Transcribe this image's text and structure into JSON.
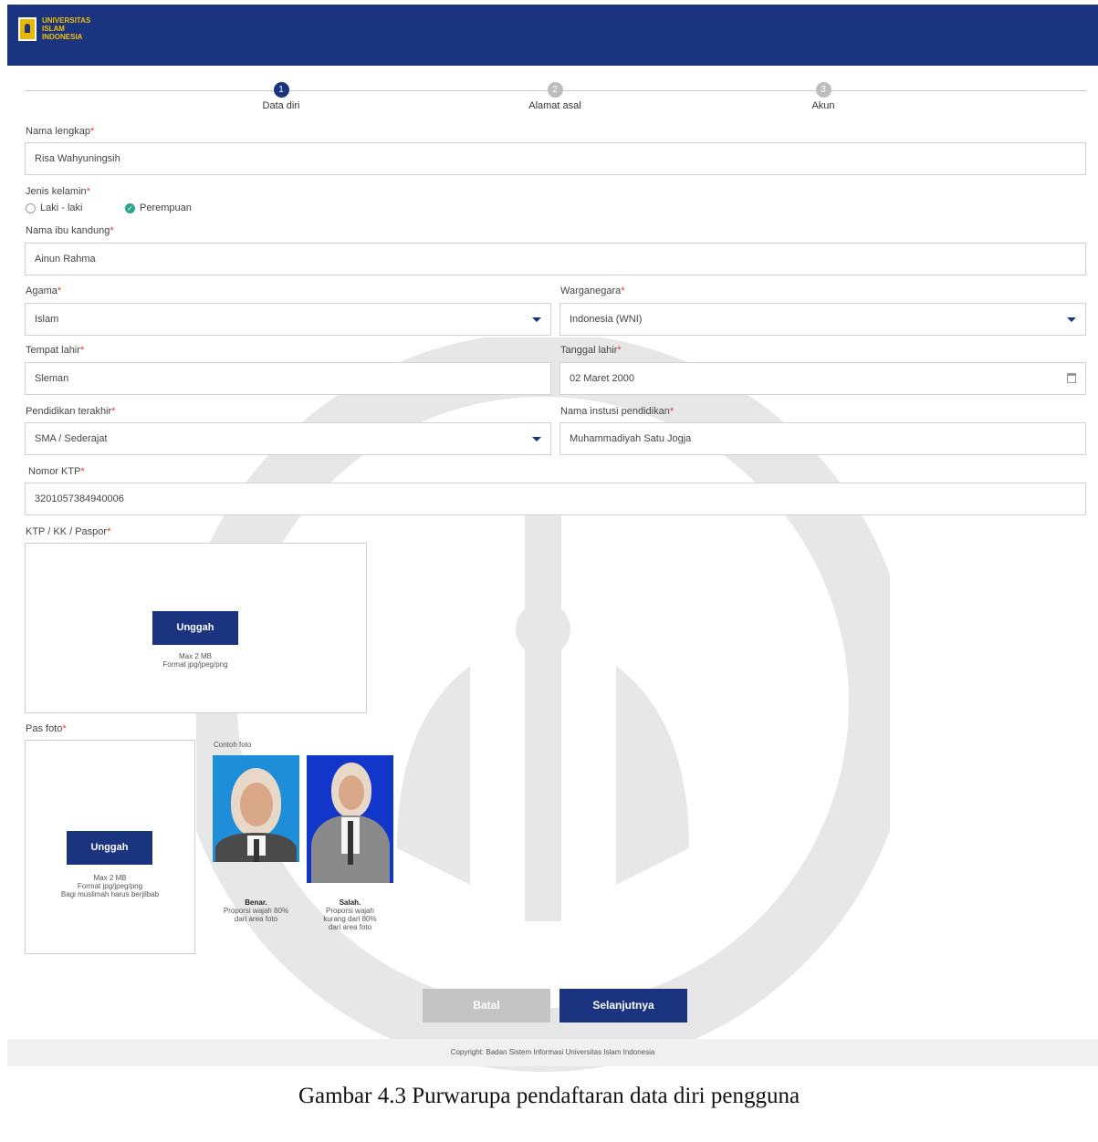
{
  "header": {
    "brand_line1": "UNIVERSITAS",
    "brand_line2": "ISLAM",
    "brand_line3": "INDONESIA",
    "brand_color": "#1b3480",
    "logo_color": "#f2c200"
  },
  "stepper": {
    "steps": [
      {
        "number": "1",
        "label": "Data diri",
        "active": true
      },
      {
        "number": "2",
        "label": "Alamat asal",
        "active": false
      },
      {
        "number": "3",
        "label": "Akun",
        "active": false
      }
    ]
  },
  "form": {
    "nama_lengkap": {
      "label": "Nama lengkap",
      "value": "Risa Wahyuningsih"
    },
    "jenis_kelamin": {
      "label": "Jenis kelamin",
      "options": [
        "Laki - laki",
        "Perempuan"
      ],
      "selected": "Perempuan"
    },
    "nama_ibu": {
      "label": "Nama ibu kandung",
      "value": "Ainun Rahma"
    },
    "agama": {
      "label": "Agama",
      "value": "Islam"
    },
    "warganegara": {
      "label": "Warganegara",
      "value": "Indonesia (WNI)"
    },
    "tempat_lahir": {
      "label": "Tempat lahir",
      "value": "Sleman"
    },
    "tanggal_lahir": {
      "label": "Tanggal lahir",
      "value": "02 Maret 2000"
    },
    "pendidikan": {
      "label": "Pendidikan terakhir",
      "value": "SMA / Sederajat"
    },
    "instansi": {
      "label": "Nama instusi pendidikan",
      "value": "Muhammadiyah Satu Jogja"
    },
    "ktp": {
      "label": "Nomor KTP",
      "value": "3201057384940006"
    },
    "required_mark": "*"
  },
  "upload_ktp": {
    "label": "KTP / KK / Paspor",
    "button": "Unggah",
    "hint_line1": "Max 2 MB",
    "hint_line2": "Format jpg/jpeg/png"
  },
  "upload_foto": {
    "label": "Pas foto",
    "button": "Unggah",
    "hint_line1": "Max 2 MB",
    "hint_line2": "Format jpg/jpeg/png",
    "hint_line3": "Bagi muslimah harus berjilbab",
    "example_label": "Contoh foto",
    "good_title": "Benar.",
    "good_line1": "Proporsi wajah 80%",
    "good_line2": "dari area foto",
    "bad_title": "Salah.",
    "bad_line1": "Proporsi wajah",
    "bad_line2": "kurang dari 80%",
    "bad_line3": "dari area foto"
  },
  "actions": {
    "cancel": "Batal",
    "next": "Selanjutnya"
  },
  "footer": {
    "copyright": "Copyright: Badan Sistem Informasi Universitas Islam Indonesia"
  },
  "caption": "Gambar 4.3 Purwarupa pendaftaran data diri pengguna"
}
